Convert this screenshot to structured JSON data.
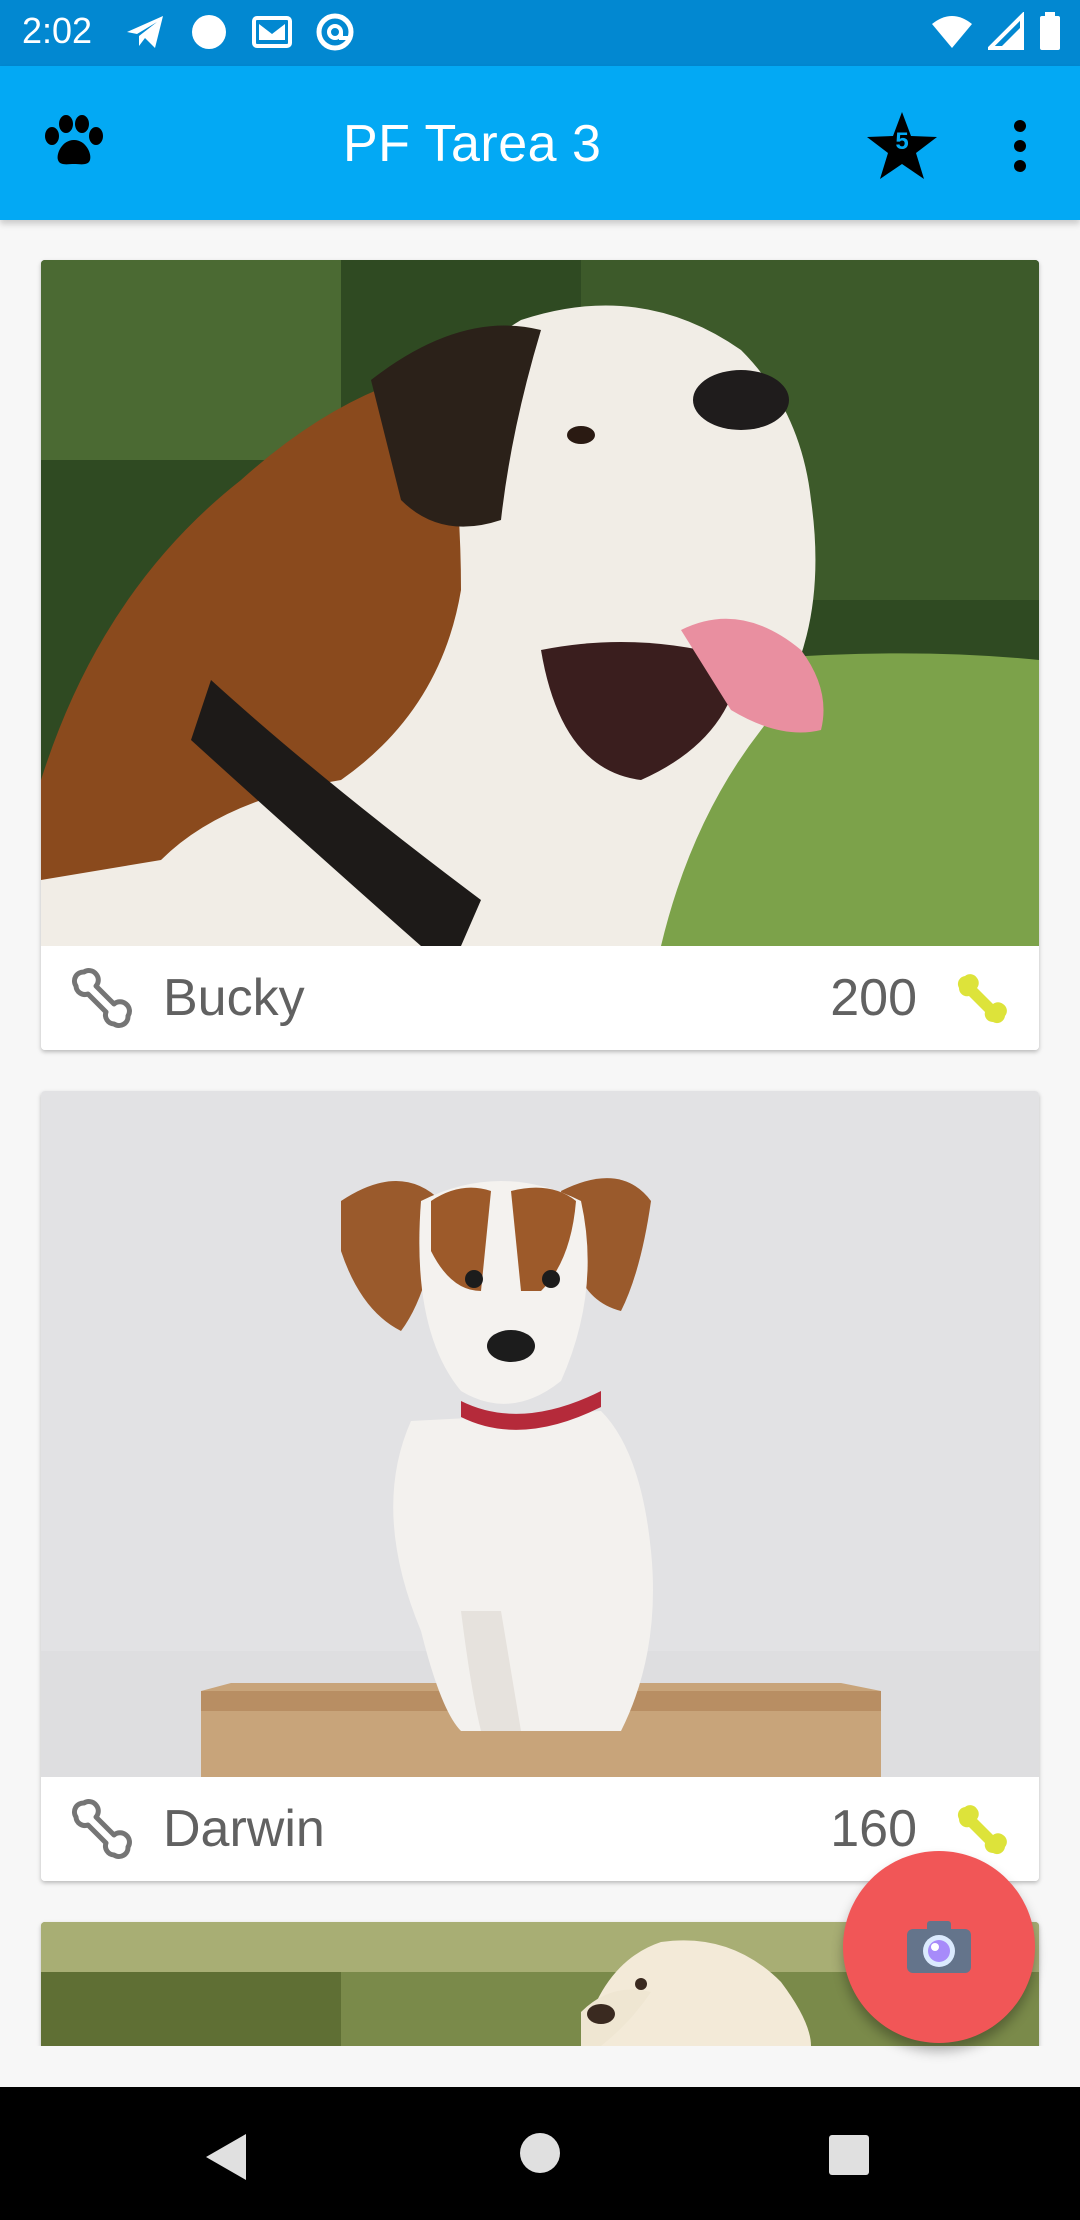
{
  "status_bar": {
    "time": "2:02",
    "left_icons": [
      "telegram-icon",
      "circle-icon",
      "gmail-icon",
      "at-sign-icon"
    ],
    "right_icons": [
      "wifi-icon",
      "signal-icon",
      "battery-icon"
    ]
  },
  "app_bar": {
    "title": "PF Tarea 3",
    "nav_icon": "paw-icon",
    "favorites_badge": "5",
    "actions": [
      "star-icon",
      "overflow-menu-icon"
    ],
    "color": "#03a9f4"
  },
  "pets": [
    {
      "name": "Bucky",
      "rating": "200",
      "image": "saint-bernard-photo"
    },
    {
      "name": "Darwin",
      "rating": "160",
      "image": "jack-russell-puppy-photo"
    },
    {
      "name": "",
      "rating": "",
      "image": "golden-retriever-puppy-photo"
    }
  ],
  "fab": {
    "icon": "camera-icon",
    "color": "#f15657"
  },
  "nav_bar": {
    "buttons": [
      "back-icon",
      "home-icon",
      "recents-icon"
    ]
  }
}
